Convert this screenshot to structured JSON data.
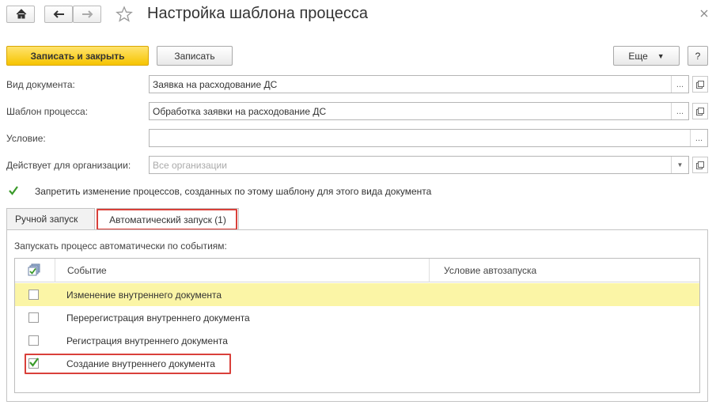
{
  "window": {
    "title": "Настройка шаблона процесса"
  },
  "toolbar": {
    "save_close_label": "Записать и закрыть",
    "save_label": "Записать",
    "more_label": "Еще",
    "help_label": "?"
  },
  "form": {
    "doc_type_label": "Вид документа:",
    "doc_type_value": "Заявка на расходование ДС",
    "template_label": "Шаблон процесса:",
    "template_value": "Обработка заявки на расходование ДС",
    "condition_label": "Условие:",
    "condition_value": "",
    "org_label": "Действует для организации:",
    "org_placeholder": "Все организации",
    "prohibit_label": "Запретить изменение процессов, созданных по этому шаблону для этого вида документа",
    "prohibit_checked": true
  },
  "tabs": [
    {
      "label": "Ручной запуск",
      "active": false
    },
    {
      "label": "Автоматический запуск (1)",
      "active": true
    }
  ],
  "events": {
    "caption": "Запускать процесс автоматически по событиям:",
    "columns": [
      "Событие",
      "Условие автозапуска"
    ],
    "rows": [
      {
        "event": "Изменение внутреннего документа",
        "condition": "",
        "checked": false,
        "selected": true
      },
      {
        "event": "Перерегистрация внутреннего документа",
        "condition": "",
        "checked": false,
        "selected": false
      },
      {
        "event": "Регистрация внутреннего документа",
        "condition": "",
        "checked": false,
        "selected": false
      },
      {
        "event": "Создание внутреннего документа",
        "condition": "",
        "checked": true,
        "selected": false
      }
    ]
  },
  "colors": {
    "accent_yellow": "#f6c400",
    "selected_row": "#fbf5a6",
    "highlight_red": "#d9403a",
    "check_green": "#3a9a2a"
  }
}
